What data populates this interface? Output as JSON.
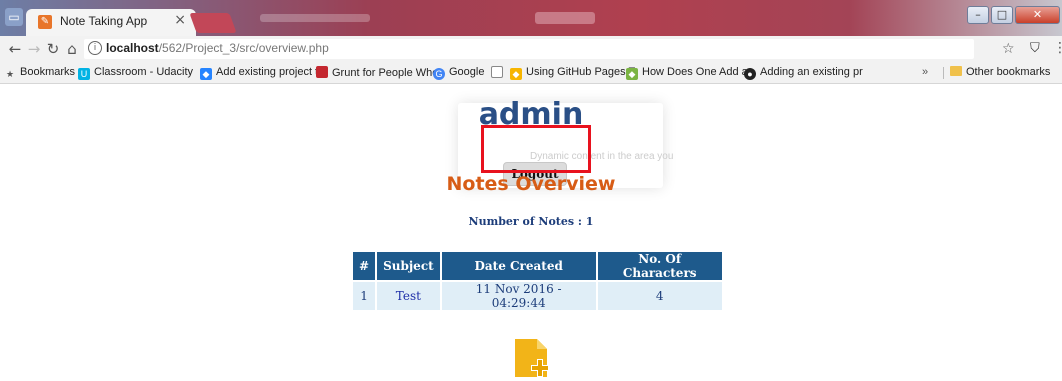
{
  "browser": {
    "tab_title": "Note Taking App",
    "tab_close": "×",
    "url_host": "localhost",
    "url_path": "/562/Project_3/src/overview.php",
    "bookmarks_label": "Bookmarks",
    "bookmarks": [
      {
        "label": "Classroom - Udacity",
        "icon": "udacity-icon",
        "color": "#02b3e4"
      },
      {
        "label": "Add existing project t",
        "icon": "sourcetree-icon",
        "color": "#2684ff"
      },
      {
        "label": "Grunt for People Who",
        "icon": "grunt-icon",
        "color": "#c4272f"
      },
      {
        "label": "Google",
        "icon": "google-icon",
        "color": "#4285f4"
      },
      {
        "label": "Using GitHub Pages T",
        "icon": "github-pages-icon",
        "color": "#f7b500"
      },
      {
        "label": "How Does One Add a",
        "icon": "sourcetree-icon",
        "color": "#7bb443"
      },
      {
        "label": "Adding an existing pr",
        "icon": "github-icon",
        "color": "#222222"
      }
    ],
    "bookmarks_overflow": "»",
    "other_bookmarks": "Other bookmarks"
  },
  "page": {
    "user_name": "admin",
    "logout_label": "Logout",
    "ghost_text": "Dynamic content in the area you",
    "section_title": "Notes Overview",
    "notes_count_text": "Number of Notes : 1",
    "table": {
      "headers": [
        "#",
        "Subject",
        "Date Created",
        "No. Of Characters"
      ],
      "rows": [
        {
          "num": "1",
          "subject": "Test",
          "date": "11 Nov 2016 - 04:29:44",
          "chars": "4"
        }
      ]
    }
  },
  "colors": {
    "accent_heading": "#2a4f86",
    "section_title": "#d75c16",
    "table_header": "#1e5a8c",
    "table_cell": "#e0eef7",
    "highlight": "#e8121e"
  }
}
